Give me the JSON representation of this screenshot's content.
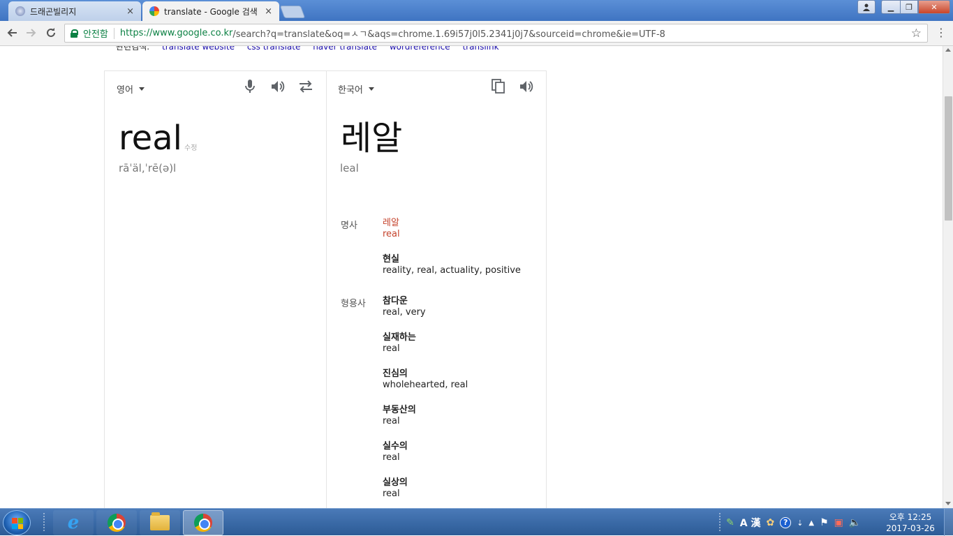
{
  "browser": {
    "tabs": [
      {
        "label": "드래곤빌리지",
        "close": "×"
      },
      {
        "label": "translate - Google 검색",
        "close": "×"
      }
    ],
    "secure_label": "안전함",
    "url_host": "https://www.google.co.kr",
    "url_rest": "/search?q=translate&oq=ㅅㄱ&aqs=chrome.1.69i57j0l5.2341j0j7&sourceid=chrome&ie=UTF-8",
    "window_controls": {
      "minimize": "▁",
      "maximize": "❐",
      "close": "✕"
    }
  },
  "related_searches": {
    "label": "관련검색:",
    "links": [
      "translate website",
      "css translate",
      "naver translate",
      "wordreference",
      "translink"
    ]
  },
  "translate": {
    "source_lang": "영어",
    "target_lang": "한국어",
    "source_text": "real",
    "edit_label": "수정",
    "source_phonetic": "rāˈäl,ˈrē(ə)l",
    "target_text": "레알",
    "target_romanization": "leal",
    "dictionary": [
      {
        "pos": "명사",
        "entries": [
          {
            "word": "레알",
            "synonyms": "real",
            "highlight": true
          },
          {
            "word": "현실",
            "synonyms": "reality, real, actuality, positive",
            "highlight": false
          }
        ]
      },
      {
        "pos": "형용사",
        "entries": [
          {
            "word": "참다운",
            "synonyms": "real, very",
            "highlight": false
          },
          {
            "word": "실재하는",
            "synonyms": "real",
            "highlight": false
          },
          {
            "word": "진심의",
            "synonyms": "wholehearted, real",
            "highlight": false
          },
          {
            "word": "부동산의",
            "synonyms": "real",
            "highlight": false
          },
          {
            "word": "실수의",
            "synonyms": "real",
            "highlight": false
          },
          {
            "word": "실상의",
            "synonyms": "real",
            "highlight": false
          }
        ]
      }
    ]
  },
  "taskbar": {
    "clock_time": "오후 12:25",
    "clock_date": "2017-03-26",
    "tray_ime": "A 漢"
  }
}
